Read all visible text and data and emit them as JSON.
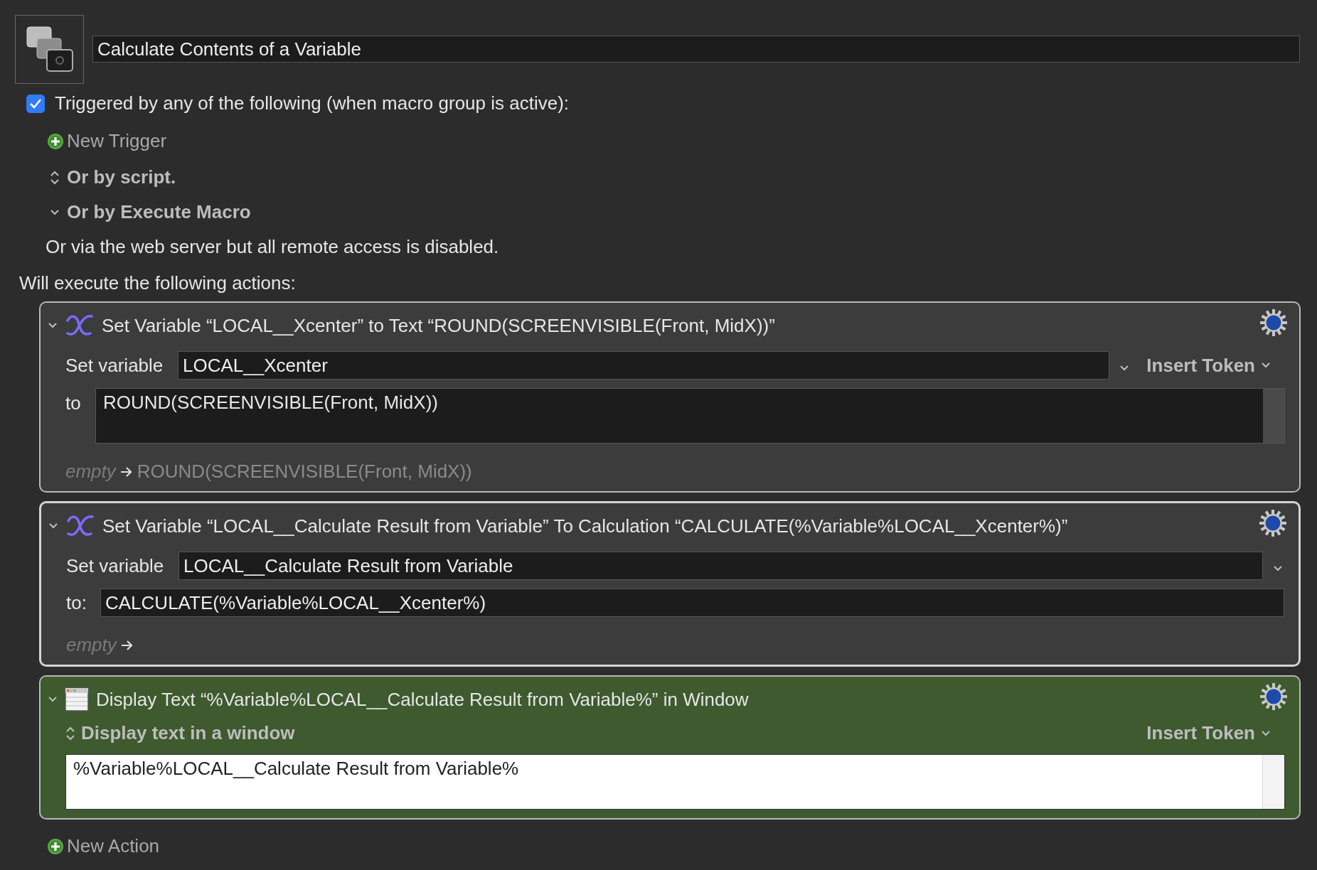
{
  "macro": {
    "name": "Calculate Contents of a Variable"
  },
  "trigger_header": {
    "label": "Triggered by any of the following (when macro group is active):",
    "checked": true
  },
  "new_trigger": "New Trigger",
  "trigger_options": [
    {
      "kind": "popup",
      "label": "Or by script."
    },
    {
      "kind": "disclosure",
      "label": "Or by Execute Macro"
    }
  ],
  "web_server_note": "Or via the web server but all remote access is disabled.",
  "actions_heading": "Will execute the following actions:",
  "actions": [
    {
      "kind": "set_text",
      "title": "Set Variable “LOCAL__Xcenter” to Text “ROUND(SCREENVISIBLE(Front, MidX))”",
      "expanded": true,
      "selected": false,
      "variable_label": "Set variable",
      "variable": "LOCAL__Xcenter",
      "insert_token": "Insert Token",
      "to_label": "to",
      "value": "ROUND(SCREENVISIBLE(Front, MidX))",
      "preview_empty": "empty",
      "preview": "ROUND(SCREENVISIBLE(Front, MidX))"
    },
    {
      "kind": "calculation",
      "title": "Set Variable “LOCAL__Calculate Result from Variable” To Calculation “CALCULATE(%Variable%LOCAL__Xcenter%)”",
      "expanded": true,
      "selected": true,
      "variable_label": "Set variable",
      "variable": "LOCAL__Calculate Result from Variable",
      "to_label": "to:",
      "value": "CALCULATE(%Variable%LOCAL__Xcenter%)",
      "preview_empty": "empty"
    },
    {
      "kind": "display",
      "title": "Display Text “%Variable%LOCAL__Calculate Result from Variable%” in Window",
      "expanded": true,
      "selected": false,
      "mode": "Display text in a window",
      "insert_token": "Insert Token",
      "value": "%Variable%LOCAL__Calculate Result from Variable%"
    }
  ],
  "new_action": "New Action"
}
